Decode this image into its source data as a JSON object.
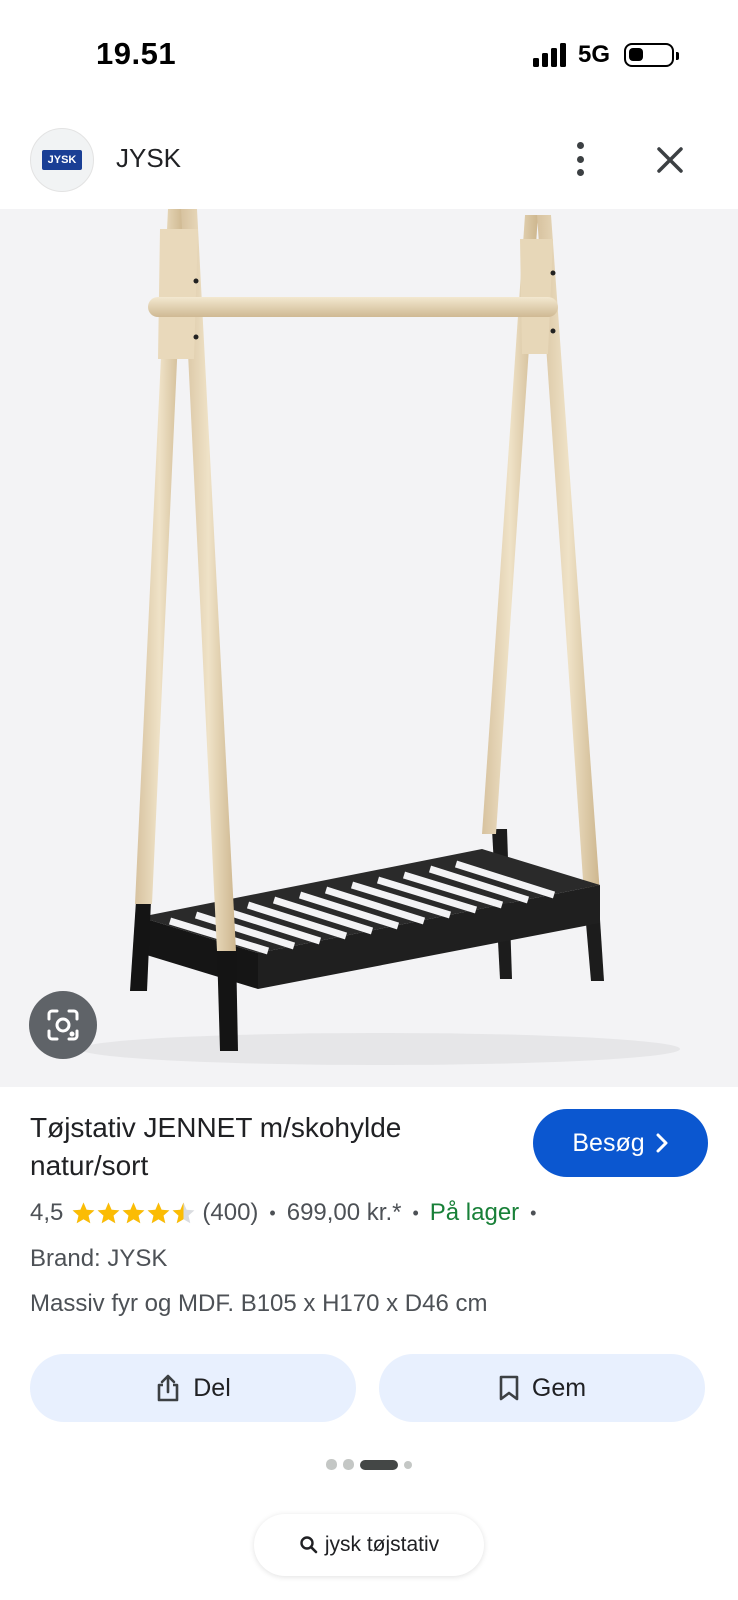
{
  "status_bar": {
    "time": "19.51",
    "network": "5G",
    "battery_level": 0.35
  },
  "header": {
    "site_name": "JYSK",
    "logo_text": "JYSK"
  },
  "product": {
    "title": "Tøjstativ JENNET m/skohylde natur/sort",
    "visit_label": "Besøg",
    "rating": "4,5",
    "rating_value": 4.5,
    "rating_max": 5,
    "review_count": "(400)",
    "price": "699,00 kr.*",
    "availability": "På lager",
    "brand": "Brand: JYSK",
    "description": "Massiv fyr og MDF. B105 x H170 x D46 cm"
  },
  "actions": {
    "share_label": "Del",
    "save_label": "Gem"
  },
  "pager": {
    "count": 4,
    "active_index": 2
  },
  "search_chip": {
    "query": "jysk tøjstativ"
  },
  "colors": {
    "accent": "#0b57d0",
    "stock_green": "#188038",
    "star_yellow": "#fbbc04",
    "chip_bg": "#e8f0fe"
  },
  "icons": {
    "menu": "more-vertical-icon",
    "close": "close-icon",
    "lens": "google-lens-icon",
    "share": "share-icon",
    "save": "bookmark-icon",
    "search": "search-icon"
  }
}
